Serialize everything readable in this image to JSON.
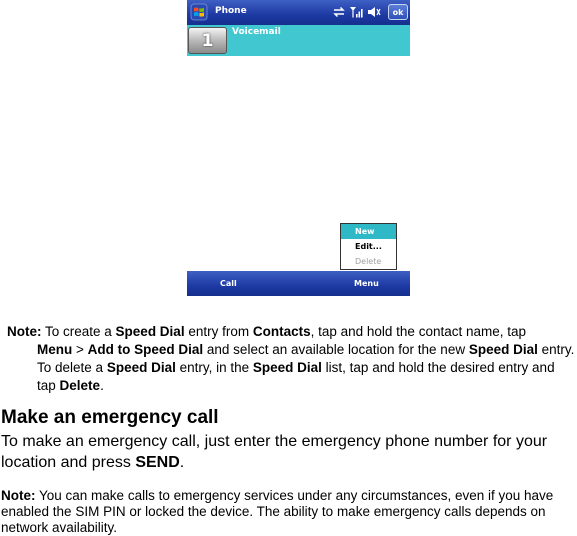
{
  "phone": {
    "title": "Phone",
    "ok_label": "ok",
    "speed_dial": {
      "number": "1",
      "name": "Voicemail"
    },
    "menu_items": [
      "New",
      "Edit...",
      "Delete"
    ],
    "softkey_left": "Call",
    "softkey_right": "Menu",
    "icons": [
      "windows-start-icon",
      "sync-icon",
      "signal-icon",
      "speaker-icon"
    ]
  },
  "note1": {
    "label": "Note:",
    "t1": " To create a ",
    "b1": "Speed Dial",
    "t2": " entry from ",
    "b2": "Contacts",
    "t3": ", tap and hold the contact name, tap ",
    "b3": "Menu",
    "t4": " > ",
    "b4": "Add to Speed Dial",
    "t5": " and select an available location for the new ",
    "b5": "Speed Dial",
    "t6": " entry. To delete a ",
    "b6": "Speed Dial",
    "t7": " entry, in the ",
    "b7": "Speed Dial",
    "t8": " list, tap and hold the desired entry and tap ",
    "b8": "Delete",
    "t9": "."
  },
  "heading": "Make an emergency call",
  "para": {
    "t1": "To make an emergency call, just enter the emergency phone number for your location and press ",
    "b1": "SEND",
    "t2": "."
  },
  "note2": {
    "label": "Note:",
    "text": " You can make calls to emergency services under any circumstances, even if you have enabled the SIM PIN or locked the device. The ability to make emergency calls depends on network availability."
  },
  "colors": {
    "title_bar": "#1d3aa3",
    "highlight": "#40c7cf",
    "menu_selected": "#2fb8c6"
  }
}
